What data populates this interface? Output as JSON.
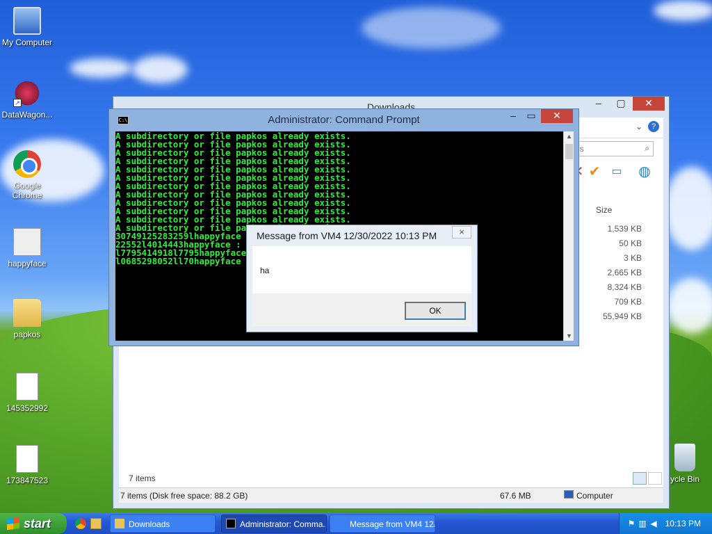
{
  "desktop": {
    "icons": [
      {
        "label": "My Computer"
      },
      {
        "label": "DataWagon..."
      },
      {
        "label": "Google Chrome"
      },
      {
        "label": "happyface"
      },
      {
        "label": "papkos"
      },
      {
        "label": "145352992"
      },
      {
        "label": "173847523"
      },
      {
        "label": "ycle Bin"
      }
    ]
  },
  "explorer": {
    "title": "Downloads",
    "search_placeholder": "ds",
    "column_size": "Size",
    "sizes": [
      "1,539 KB",
      "50 KB",
      "3 KB",
      "2,665 KB",
      "8,324 KB",
      "709 KB",
      "55,949 KB"
    ],
    "item_count": "7 items",
    "status": {
      "left": "7 items (Disk free space: 88.2 GB)",
      "size": "67.6 MB",
      "location": "Computer"
    }
  },
  "cmd": {
    "title": "Administrator:  Command Prompt",
    "lines": [
      "A subdirectory or file papkos already exists.",
      "A subdirectory or file papkos already exists.",
      "A subdirectory or file papkos already exists.",
      "A subdirectory or file papkos already exists.",
      "A subdirectory or file papkos already exists.",
      "A subdirectory or file papkos already exists.",
      "A subdirectory or file papkos already exists.",
      "A subdirectory or file papkos already exists.",
      "A subdirectory or file papkos already exists.",
      "A subdirectory or file papkos already exists.",
      "A subdirectory or file papkos already exists.",
      "A subdirectory or file papkos already exists.",
      "30749125283259lhappyface",
      "22552l4014443happyface :",
      "l7795414918l7795happyface",
      "l0685298052ll70happyface"
    ]
  },
  "msgbox": {
    "title": "Message from VM4 12/30/2022 10:13 PM",
    "text": "ha",
    "ok_label": "OK",
    "close_glyph": "×"
  },
  "taskbar": {
    "start_label": "start",
    "tasks": [
      {
        "label": "Downloads"
      },
      {
        "label": "Administrator:  Comma..."
      },
      {
        "label": "Message from VM4 12/..."
      }
    ],
    "clock": "10:13 PM"
  }
}
